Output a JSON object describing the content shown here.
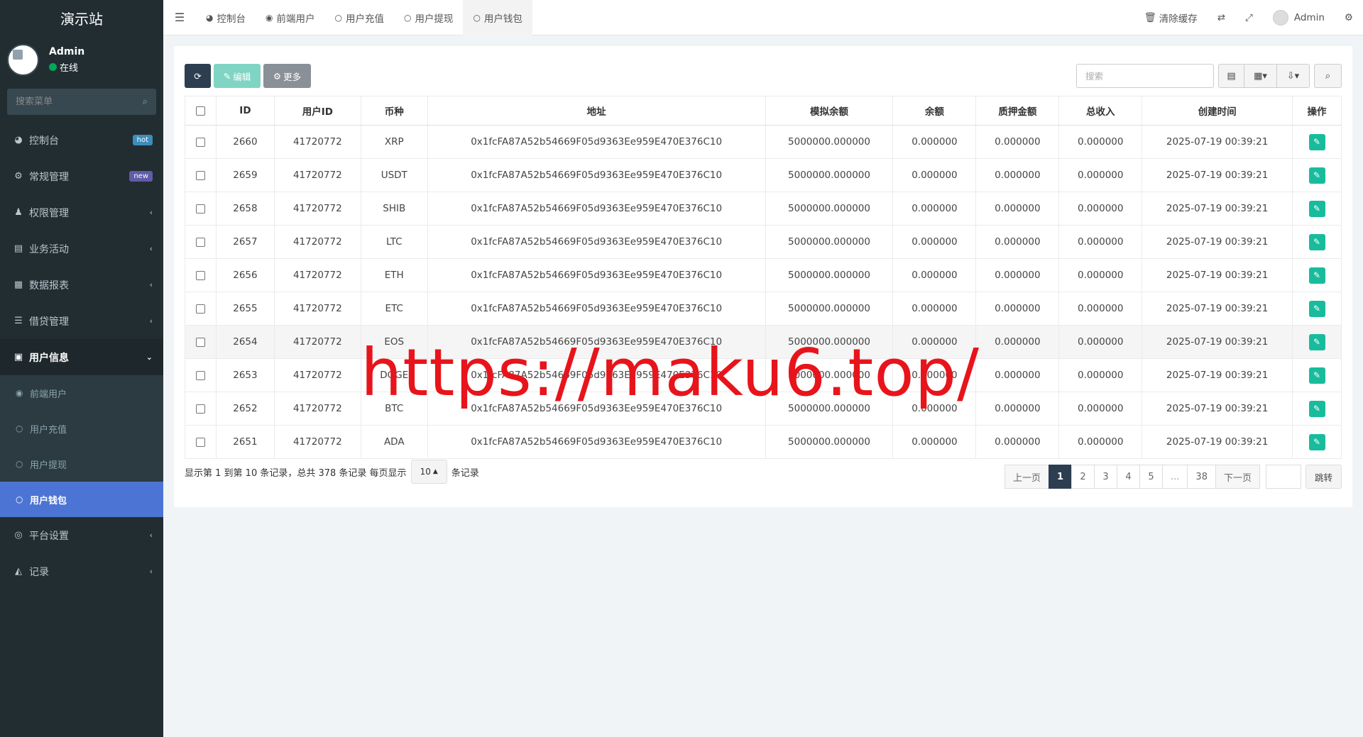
{
  "sidebar": {
    "brand": "演示站",
    "user": {
      "name": "Admin",
      "status": "在线"
    },
    "search_placeholder": "搜索菜单",
    "menu": [
      {
        "icon": "dashboard-icon",
        "glyph": "◕",
        "label": "控制台",
        "badge": "hot"
      },
      {
        "icon": "cogs-icon",
        "glyph": "⚙",
        "label": "常规管理",
        "badge": "new"
      },
      {
        "icon": "users-icon",
        "glyph": "👥",
        "label": "权限管理"
      },
      {
        "icon": "activity-icon",
        "glyph": "▤",
        "label": "业务活动"
      },
      {
        "icon": "report-icon",
        "glyph": "▦",
        "label": "数据报表"
      },
      {
        "icon": "list-icon",
        "glyph": "☰",
        "label": "借贷管理"
      },
      {
        "icon": "user-info-icon",
        "glyph": "▣",
        "label": "用户信息"
      }
    ],
    "submenu": [
      {
        "label": "前端用户"
      },
      {
        "label": "用户充值"
      },
      {
        "label": "用户提现"
      },
      {
        "label": "用户钱包"
      }
    ],
    "menu_after": [
      {
        "label": "平台设置"
      },
      {
        "label": "记录"
      }
    ]
  },
  "header": {
    "tabs": [
      {
        "label": "控制台"
      },
      {
        "label": "前端用户"
      },
      {
        "label": "用户充值"
      },
      {
        "label": "用户提现"
      },
      {
        "label": "用户钱包"
      }
    ],
    "clear_cache": "清除缓存",
    "admin": "Admin"
  },
  "toolbar": {
    "edit_label": "编辑",
    "more_label": "更多",
    "search_placeholder": "搜索"
  },
  "table": {
    "columns": [
      "ID",
      "用户ID",
      "币种",
      "地址",
      "模拟余额",
      "余额",
      "质押金额",
      "总收入",
      "创建时间",
      "操作"
    ],
    "rows": [
      [
        "2660",
        "41720772",
        "XRP",
        "0x1fcFA87A52b54669F05d9363Ee959E470E376C10",
        "5000000.000000",
        "0.000000",
        "0.000000",
        "0.000000",
        "2025-07-19 00:39:21"
      ],
      [
        "2659",
        "41720772",
        "USDT",
        "0x1fcFA87A52b54669F05d9363Ee959E470E376C10",
        "5000000.000000",
        "0.000000",
        "0.000000",
        "0.000000",
        "2025-07-19 00:39:21"
      ],
      [
        "2658",
        "41720772",
        "SHIB",
        "0x1fcFA87A52b54669F05d9363Ee959E470E376C10",
        "5000000.000000",
        "0.000000",
        "0.000000",
        "0.000000",
        "2025-07-19 00:39:21"
      ],
      [
        "2657",
        "41720772",
        "LTC",
        "0x1fcFA87A52b54669F05d9363Ee959E470E376C10",
        "5000000.000000",
        "0.000000",
        "0.000000",
        "0.000000",
        "2025-07-19 00:39:21"
      ],
      [
        "2656",
        "41720772",
        "ETH",
        "0x1fcFA87A52b54669F05d9363Ee959E470E376C10",
        "5000000.000000",
        "0.000000",
        "0.000000",
        "0.000000",
        "2025-07-19 00:39:21"
      ],
      [
        "2655",
        "41720772",
        "ETC",
        "0x1fcFA87A52b54669F05d9363Ee959E470E376C10",
        "5000000.000000",
        "0.000000",
        "0.000000",
        "0.000000",
        "2025-07-19 00:39:21"
      ],
      [
        "2654",
        "41720772",
        "EOS",
        "0x1fcFA87A52b54669F05d9363Ee959E470E376C10",
        "5000000.000000",
        "0.000000",
        "0.000000",
        "0.000000",
        "2025-07-19 00:39:21"
      ],
      [
        "2653",
        "41720772",
        "DOGE",
        "0x1fcFA87A52b54669F05d9363Ee959E470E376C10",
        "5000000.000000",
        "0.000000",
        "0.000000",
        "0.000000",
        "2025-07-19 00:39:21"
      ],
      [
        "2652",
        "41720772",
        "BTC",
        "0x1fcFA87A52b54669F05d9363Ee959E470E376C10",
        "5000000.000000",
        "0.000000",
        "0.000000",
        "0.000000",
        "2025-07-19 00:39:21"
      ],
      [
        "2651",
        "41720772",
        "ADA",
        "0x1fcFA87A52b54669F05d9363Ee959E470E376C10",
        "5000000.000000",
        "0.000000",
        "0.000000",
        "0.000000",
        "2025-07-19 00:39:21"
      ]
    ]
  },
  "pager": {
    "info": "显示第 1 到第 10 条记录，总共 378 条记录 每页显示",
    "page_size": "10",
    "suffix": "条记录",
    "prev": "上一页",
    "pages": [
      "1",
      "2",
      "3",
      "4",
      "5",
      "...",
      "38"
    ],
    "next": "下一页",
    "jump": "跳转"
  },
  "watermark": "https://maku6.top/",
  "colors": {
    "sidebar_bg": "#222d32",
    "active_sub": "#4c74d4",
    "primary": "#2c3e50",
    "success": "#18bc9c",
    "watermark": "#e8141b"
  }
}
